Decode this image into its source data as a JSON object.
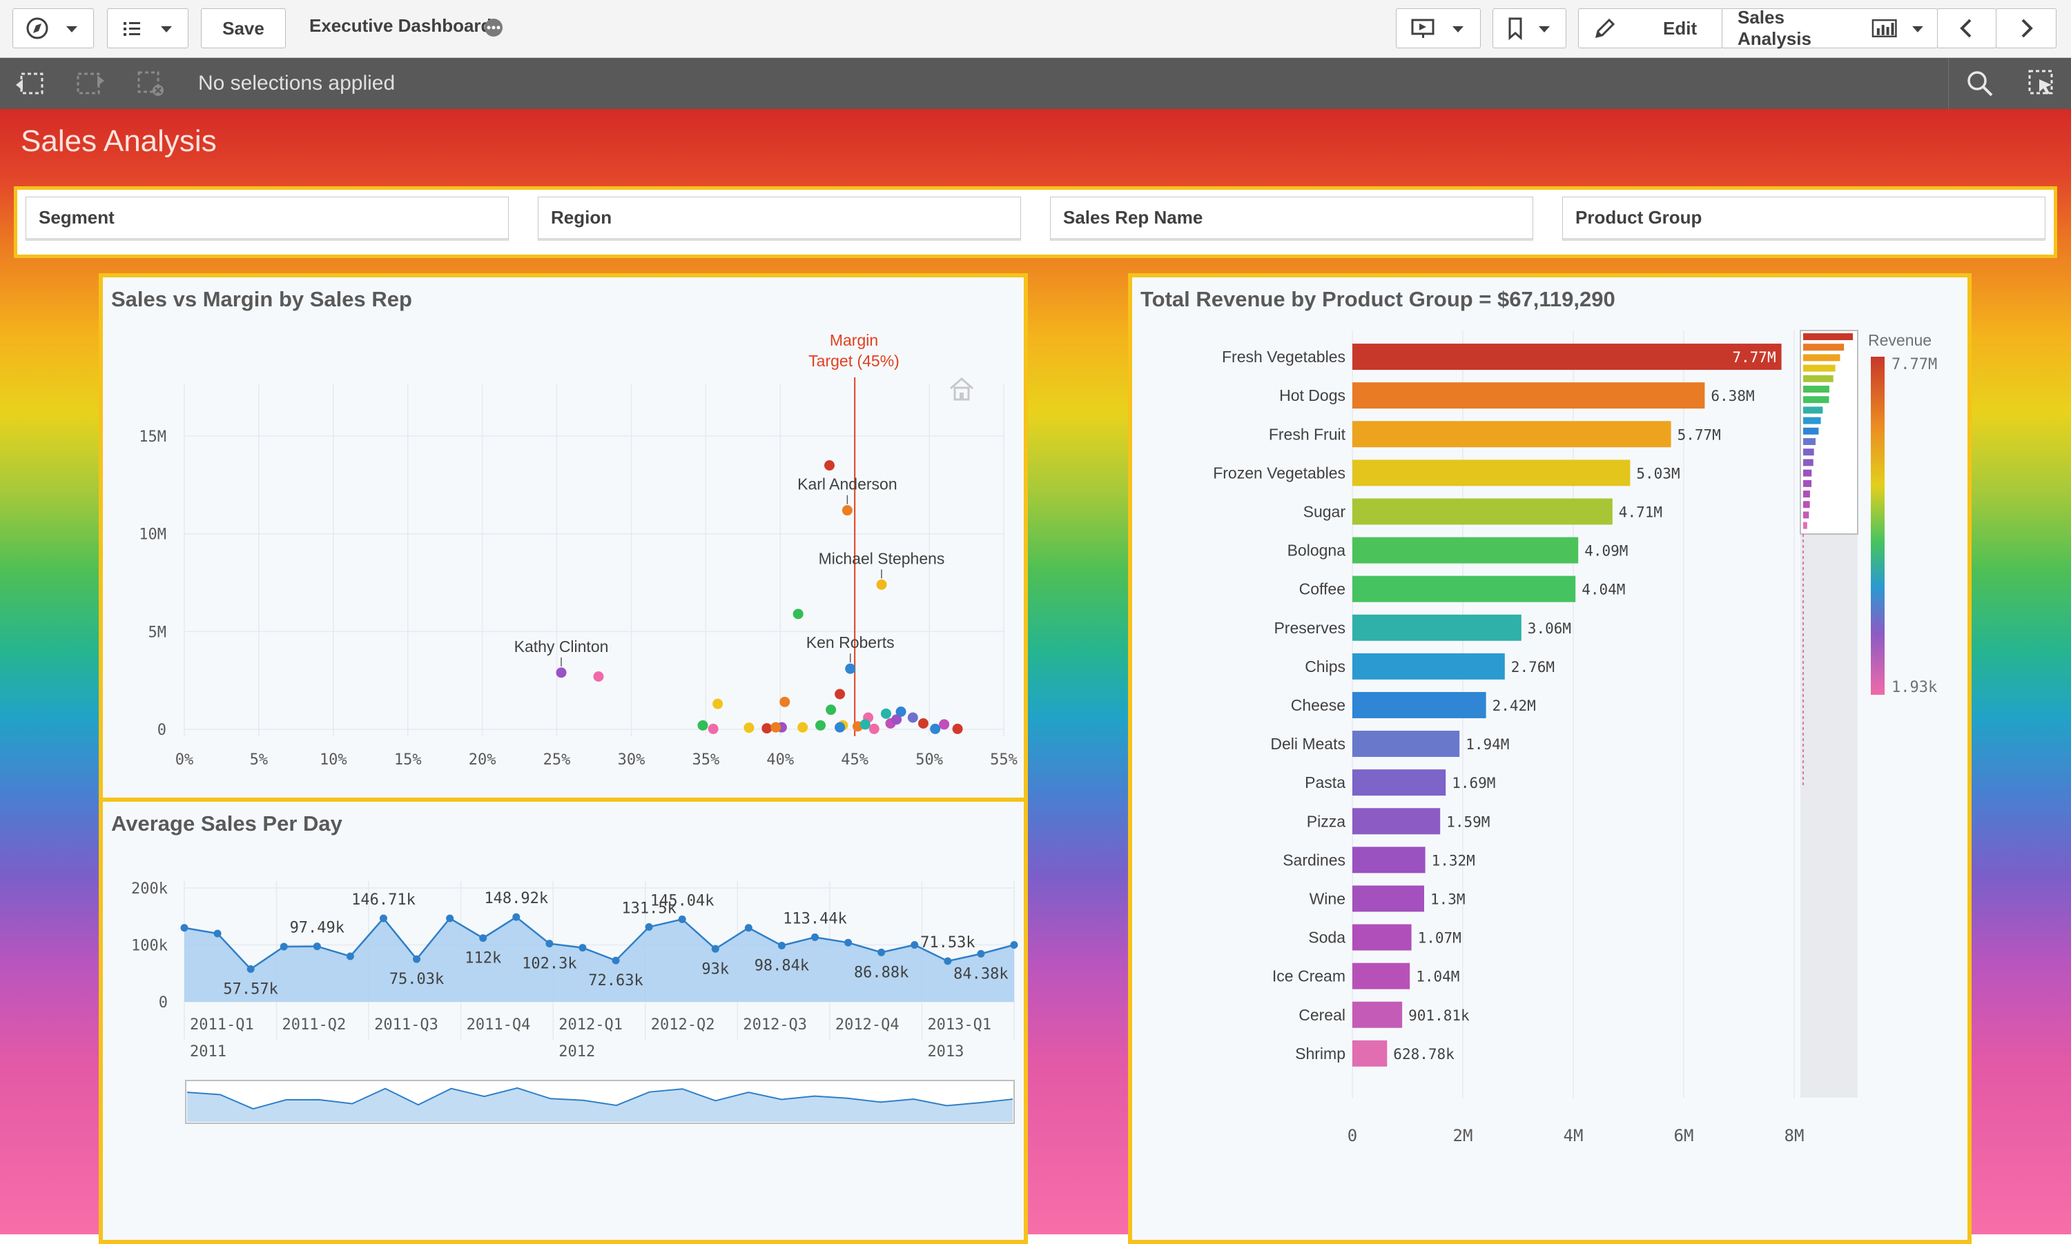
{
  "toolbar": {
    "app_title": "Executive Dashboard",
    "save_label": "Save",
    "edit_label": "Edit",
    "sheet_name": "Sales Analysis"
  },
  "selections": {
    "message": "No selections applied"
  },
  "sheet": {
    "title": "Sales Analysis"
  },
  "filters": [
    "Segment",
    "Region",
    "Sales Rep Name",
    "Product Group"
  ],
  "scatter": {
    "title": "Sales vs Margin by Sales Rep",
    "ref_line_label_1": "Margin",
    "ref_line_label_2": "Target (45%)",
    "xticks": [
      "0%",
      "5%",
      "10%",
      "15%",
      "20%",
      "25%",
      "30%",
      "35%",
      "40%",
      "45%",
      "50%",
      "55%"
    ],
    "yticks": [
      "15M",
      "10M",
      "5M",
      "0"
    ]
  },
  "line": {
    "title": "Average Sales Per Day",
    "yticks": [
      "200k",
      "100k",
      "0"
    ],
    "quarters": [
      "2011-Q1",
      "2011-Q2",
      "2011-Q3",
      "2011-Q4",
      "2012-Q1",
      "2012-Q2",
      "2012-Q3",
      "2012-Q4",
      "2013-Q1"
    ],
    "years": [
      "2011",
      "2012",
      "2013"
    ]
  },
  "bar": {
    "title": "Total Revenue by Product Group = $67,119,290",
    "legend_title": "Revenue",
    "legend_max": "7.77M",
    "legend_min": "1.93k",
    "xticks": [
      "0",
      "2M",
      "4M",
      "6M",
      "8M"
    ]
  },
  "chart_data": [
    {
      "type": "scatter",
      "title": "Sales vs Margin by Sales Rep",
      "x_unit": "margin %",
      "y_unit": "sales",
      "xlim": [
        0,
        55
      ],
      "ylim": [
        0,
        15000000
      ],
      "reference_line": {
        "x": 45,
        "label": "Margin Target (45%)",
        "color": "#e0401f"
      },
      "points": [
        {
          "x": 43.3,
          "y": 13500000,
          "color": "#d13a2a"
        },
        {
          "x": 44.5,
          "y": 11200000,
          "color": "#ec7d22",
          "label": "Karl Anderson"
        },
        {
          "x": 46.8,
          "y": 7400000,
          "color": "#f2b81b",
          "label": "Michael Stephens"
        },
        {
          "x": 41.2,
          "y": 5900000,
          "color": "#32bd57"
        },
        {
          "x": 44.7,
          "y": 3100000,
          "color": "#2e86d4",
          "label": "Ken Roberts"
        },
        {
          "x": 25.3,
          "y": 2900000,
          "color": "#9b52c2",
          "label": "Kathy Clinton"
        },
        {
          "x": 27.8,
          "y": 2700000,
          "color": "#f06aa8"
        },
        {
          "x": 35.8,
          "y": 1300000,
          "color": "#f2c31b"
        },
        {
          "x": 40.3,
          "y": 1400000,
          "color": "#ec7d22"
        },
        {
          "x": 44.0,
          "y": 1800000,
          "color": "#d13a2a"
        },
        {
          "x": 43.4,
          "y": 1000000,
          "color": "#32bd57"
        },
        {
          "x": 47.1,
          "y": 800000,
          "color": "#27b5a7"
        },
        {
          "x": 48.1,
          "y": 900000,
          "color": "#2e86d4"
        },
        {
          "x": 48.9,
          "y": 600000,
          "color": "#6f6fcf"
        },
        {
          "x": 49.6,
          "y": 300000,
          "color": "#d13a2a"
        },
        {
          "x": 47.4,
          "y": 300000,
          "color": "#c14fb8"
        },
        {
          "x": 45.9,
          "y": 600000,
          "color": "#f06aa8"
        },
        {
          "x": 44.2,
          "y": 200000,
          "color": "#f2c31b"
        },
        {
          "x": 42.7,
          "y": 200000,
          "color": "#32bd57"
        },
        {
          "x": 41.5,
          "y": 100000,
          "color": "#f2c31b"
        },
        {
          "x": 40.1,
          "y": 100000,
          "color": "#9b52c2"
        },
        {
          "x": 39.1,
          "y": 50000,
          "color": "#d13a2a"
        },
        {
          "x": 34.8,
          "y": 200000,
          "color": "#32bd57"
        },
        {
          "x": 35.5,
          "y": 20000,
          "color": "#f06aa8"
        },
        {
          "x": 37.9,
          "y": 80000,
          "color": "#f2c31b"
        },
        {
          "x": 39.7,
          "y": 100000,
          "color": "#ec7d22"
        },
        {
          "x": 44.0,
          "y": 100000,
          "color": "#2e86d4"
        },
        {
          "x": 45.2,
          "y": 150000,
          "color": "#ec7d22"
        },
        {
          "x": 45.7,
          "y": 250000,
          "color": "#27b5a7"
        },
        {
          "x": 50.4,
          "y": 20000,
          "color": "#2e86d4"
        },
        {
          "x": 51.0,
          "y": 250000,
          "color": "#c14fb8"
        },
        {
          "x": 51.9,
          "y": 20000,
          "color": "#d13a2a"
        },
        {
          "x": 46.3,
          "y": 20000,
          "color": "#f06aa8"
        },
        {
          "x": 47.8,
          "y": 500000,
          "color": "#9b52c2"
        }
      ]
    },
    {
      "type": "area",
      "title": "Average Sales Per Day",
      "ylim": [
        0,
        200000
      ],
      "x_categories": [
        "2011-Q1",
        "2011-Q2",
        "2011-Q3",
        "2011-Q4",
        "2012-Q1",
        "2012-Q2",
        "2012-Q3",
        "2012-Q4",
        "2013-Q1"
      ],
      "color": "#2f7fc8",
      "values": [
        130000,
        120000,
        57570,
        97000,
        97490,
        80000,
        146710,
        75030,
        146710,
        112000,
        148920,
        102300,
        95000,
        72630,
        131500,
        145040,
        93000,
        130000,
        98840,
        113440,
        104000,
        86880,
        100000,
        71530,
        84380,
        100000
      ],
      "data_labels": [
        {
          "i": 2,
          "text": "57.57k",
          "pos": "below"
        },
        {
          "i": 4,
          "text": "97.49k",
          "pos": "above"
        },
        {
          "i": 6,
          "text": "146.71k",
          "pos": "above"
        },
        {
          "i": 7,
          "text": "75.03k",
          "pos": "below"
        },
        {
          "i": 9,
          "text": "112k",
          "pos": "below"
        },
        {
          "i": 10,
          "text": "148.92k",
          "pos": "above"
        },
        {
          "i": 11,
          "text": "102.3k",
          "pos": "below"
        },
        {
          "i": 13,
          "text": "72.63k",
          "pos": "below"
        },
        {
          "i": 14,
          "text": "131.5k",
          "pos": "above"
        },
        {
          "i": 15,
          "text": "145.04k",
          "pos": "above"
        },
        {
          "i": 16,
          "text": "93k",
          "pos": "below"
        },
        {
          "i": 18,
          "text": "98.84k",
          "pos": "below"
        },
        {
          "i": 19,
          "text": "113.44k",
          "pos": "above"
        },
        {
          "i": 21,
          "text": "86.88k",
          "pos": "below"
        },
        {
          "i": 23,
          "text": "71.53k",
          "pos": "above"
        },
        {
          "i": 24,
          "text": "84.38k",
          "pos": "below"
        }
      ]
    },
    {
      "type": "bar",
      "orientation": "horizontal",
      "title": "Total Revenue by Product Group = $67,119,290",
      "xlim": [
        0,
        8000000
      ],
      "categories": [
        "Fresh Vegetables",
        "Hot Dogs",
        "Fresh Fruit",
        "Frozen Vegetables",
        "Sugar",
        "Bologna",
        "Coffee",
        "Preserves",
        "Chips",
        "Cheese",
        "Deli Meats",
        "Pasta",
        "Pizza",
        "Sardines",
        "Wine",
        "Soda",
        "Ice Cream",
        "Cereal",
        "Shrimp"
      ],
      "values": [
        7770000,
        6380000,
        5770000,
        5030000,
        4710000,
        4090000,
        4040000,
        3060000,
        2760000,
        2420000,
        1940000,
        1690000,
        1590000,
        1320000,
        1300000,
        1070000,
        1040000,
        901810,
        628780
      ],
      "labels": [
        "7.77M",
        "6.38M",
        "5.77M",
        "5.03M",
        "4.71M",
        "4.09M",
        "4.04M",
        "3.06M",
        "2.76M",
        "2.42M",
        "1.94M",
        "1.69M",
        "1.59M",
        "1.32M",
        "1.3M",
        "1.07M",
        "1.04M",
        "901.81k",
        "628.78k"
      ],
      "colors": [
        "#c8382a",
        "#e97b24",
        "#eda31d",
        "#e3c51c",
        "#a8c535",
        "#4cc25a",
        "#45c360",
        "#2fb0a8",
        "#2a9ad1",
        "#2e86d4",
        "#6a78cc",
        "#7c64c8",
        "#8c5bc4",
        "#9a52c0",
        "#a450be",
        "#b04fb9",
        "#b851b7",
        "#c45bb6",
        "#e06eb1"
      ]
    }
  ]
}
